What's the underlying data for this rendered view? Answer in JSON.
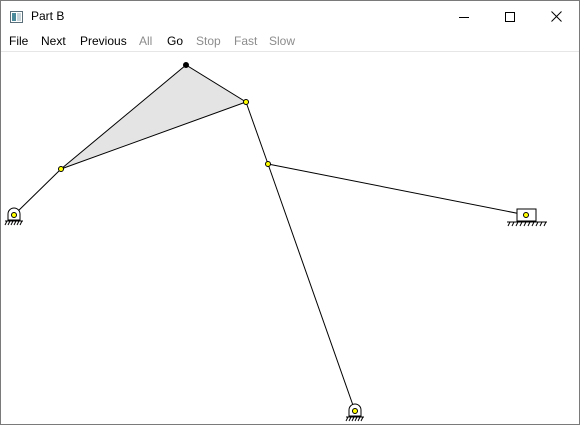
{
  "window": {
    "title": "Part B",
    "icon": "app-window-icon"
  },
  "controls": {
    "minimize_icon": "minimize-icon",
    "maximize_icon": "maximize-icon",
    "close_icon": "close-icon"
  },
  "menu": {
    "items": [
      {
        "label": "File",
        "enabled": true
      },
      {
        "label": "Next",
        "enabled": true
      },
      {
        "label": "Previous",
        "enabled": true
      },
      {
        "label": "All",
        "enabled": false
      },
      {
        "label": "Go",
        "enabled": true
      },
      {
        "label": "Stop",
        "enabled": false
      },
      {
        "label": "Fast",
        "enabled": false
      },
      {
        "label": "Slow",
        "enabled": false
      }
    ]
  },
  "colors": {
    "joint_fill": "#ffff00",
    "link_stroke": "#000000",
    "coupler_fill": "#e4e4e4",
    "disabled_text": "#8c8c8c"
  }
}
